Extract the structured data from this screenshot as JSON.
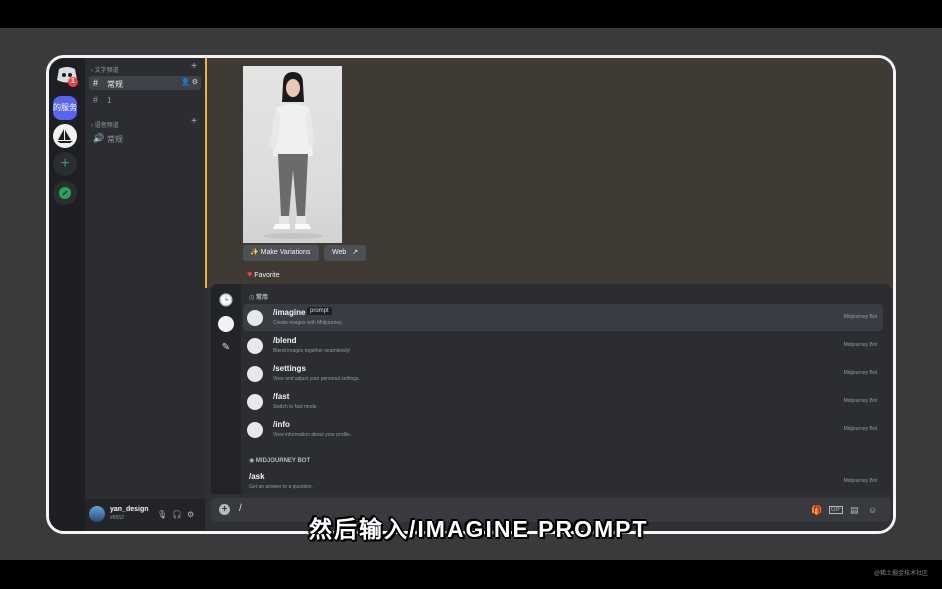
{
  "server_rail": {
    "notification_count": "1",
    "server_label": "的服务器"
  },
  "channel_list": {
    "text_category": "文字频道",
    "text_channels": [
      "常规",
      "1"
    ],
    "voice_category": "语音频道",
    "voice_channels": [
      "常规"
    ]
  },
  "user_panel": {
    "username": "yan_design",
    "tag": "#6552"
  },
  "message": {
    "buttons": {
      "make_variations": "Make Variations",
      "web": "Web",
      "favorite": "Favorite"
    }
  },
  "command_popup": {
    "section_frequent": "常用",
    "section_bot": "MIDJOURNEY BOT",
    "commands": [
      {
        "name": "/imagine",
        "option": "prompt",
        "desc": "Create images with Midjourney",
        "source": "Midjourney Bot"
      },
      {
        "name": "/blend",
        "desc": "Blend images together seamlessly!",
        "source": "Midjourney Bot"
      },
      {
        "name": "/settings",
        "desc": "View and adjust your personal settings.",
        "source": "Midjourney Bot"
      },
      {
        "name": "/fast",
        "desc": "Switch to fast mode",
        "source": "Midjourney Bot"
      },
      {
        "name": "/info",
        "desc": "View information about your profile.",
        "source": "Midjourney Bot"
      }
    ],
    "bot_commands": [
      {
        "name": "/ask",
        "desc": "Get an answer to a question.",
        "source": "Midjourney Bot"
      }
    ]
  },
  "input": {
    "typed_value": "/",
    "gif_label": "GIF"
  },
  "subtitle": "然后输入/IMAGINE PROMPT",
  "watermark": "@稀土掘金技术社区",
  "colors": {
    "blurple": "#5865f2",
    "highlight_bar": "#f0b232",
    "favorite_heart": "#ed4245"
  }
}
